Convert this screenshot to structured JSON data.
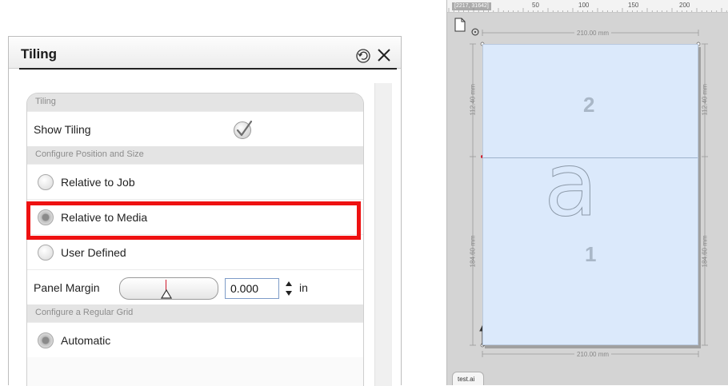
{
  "panel": {
    "title": "Tiling",
    "sections": {
      "tiling": "Tiling",
      "position": "Configure Position and Size",
      "grid": "Configure a Regular Grid"
    },
    "show_tiling": {
      "label": "Show Tiling",
      "checked": true
    },
    "options": {
      "relative_job": {
        "label": "Relative to Job",
        "selected": false
      },
      "relative_media": {
        "label": "Relative to Media",
        "selected": true
      },
      "user_defined": {
        "label": "User Defined",
        "selected": false
      }
    },
    "panel_margin": {
      "label": "Panel Margin",
      "value": "0.000",
      "unit": "in"
    },
    "automatic": {
      "label": "Automatic",
      "selected": true
    }
  },
  "canvas": {
    "ruler_coords": "[2217, 31642]",
    "ruler_numbers": [
      "50",
      "100",
      "150",
      "200"
    ],
    "dim_width_top": "210.00 mm",
    "dim_width_bottom": "210.00 mm",
    "dim_tile2_height": "112.40 mm",
    "dim_tile1_height": "184.60 mm",
    "tile_2": "2",
    "tile_1": "1",
    "glyph": "a",
    "file_tab": "test.ai"
  },
  "colors": {
    "highlight": "#ee1111",
    "media_fill": "#dbe9fb",
    "marker_red": "#d0192b"
  }
}
